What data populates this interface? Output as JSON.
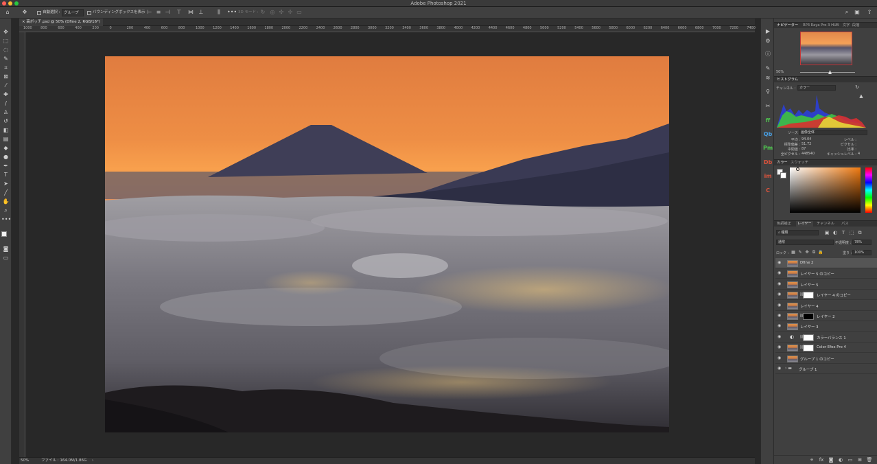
{
  "window": {
    "title": "Adobe Photoshop 2021"
  },
  "options_bar": {
    "auto_select_label": "自動選択 :",
    "auto_select_target": "グループ",
    "bounding_box_label": "バウンディングボックスを表示",
    "mode_3d_label": "3D モード :"
  },
  "document_tab": {
    "label": "高ボッチ.psd @ 50% (Dfine 2, RGB/16*)",
    "close": "×"
  },
  "ruler_top": [
    "1000",
    "800",
    "600",
    "400",
    "200",
    "0",
    "200",
    "400",
    "600",
    "800",
    "1000",
    "1200",
    "1400",
    "1600",
    "1800",
    "2000",
    "2200",
    "2400",
    "2600",
    "2800",
    "3000",
    "3200",
    "3400",
    "3600",
    "3800",
    "4000",
    "4200",
    "4400",
    "4600",
    "4800",
    "5000",
    "5200",
    "5400",
    "5600",
    "5800",
    "6000",
    "6200",
    "6400",
    "6600",
    "6800",
    "7000",
    "7200",
    "7400"
  ],
  "status": {
    "zoom": "50%",
    "file_info": "ファイル : 164.0M/1.86G",
    "arrow": "›"
  },
  "navigator": {
    "tabs": [
      "ナビゲーター",
      "RP3 Raya Pro 3 HUB",
      "文字",
      "段落"
    ],
    "zoom": "50%"
  },
  "histogram": {
    "title": "ヒストグラム",
    "channel_label": "チャンネル :",
    "channel_value": "カラー",
    "source_label": "ソース :",
    "source_value": "画像全体",
    "stats": [
      {
        "label": "平均 :",
        "value": "94.04"
      },
      {
        "label": "標準偏差 :",
        "value": "51.72"
      },
      {
        "label": "中間値 :",
        "value": "87"
      },
      {
        "label": "全ピクセル :",
        "value": "448540"
      }
    ],
    "stats_right": [
      {
        "label": "レベル :",
        "value": ""
      },
      {
        "label": "ピクセル :",
        "value": ""
      },
      {
        "label": "比率 :",
        "value": ""
      },
      {
        "label": "キャッシュレベル :",
        "value": "4"
      }
    ]
  },
  "color_panel": {
    "tabs": [
      "カラー",
      "スウォッチ"
    ]
  },
  "layers_panel": {
    "tabs": [
      "色調補正",
      "レイヤー",
      "チャンネル",
      "パス"
    ],
    "filter_kind": "種類",
    "blend_mode": "通常",
    "opacity_label": "不透明度 :",
    "opacity_value": "78%",
    "lock_label": "ロック :",
    "fill_label": "塗り :",
    "fill_value": "100%",
    "layers": [
      {
        "name": "Dfine 2",
        "mask": "",
        "selected": true
      },
      {
        "name": "レイヤー 5 のコピー",
        "mask": ""
      },
      {
        "name": "レイヤー 5",
        "mask": ""
      },
      {
        "name": "レイヤー 4 のコピー",
        "mask": "white"
      },
      {
        "name": "レイヤー 4",
        "mask": ""
      },
      {
        "name": "レイヤー 2",
        "mask": "black"
      },
      {
        "name": "レイヤー 3",
        "mask": ""
      },
      {
        "name": "カラーバランス 1",
        "mask": "white",
        "adjustment": true
      },
      {
        "name": "Color Efex Pro 4",
        "mask": "white"
      },
      {
        "name": "グループ 1 のコピー",
        "mask": ""
      },
      {
        "name": "グループ 1",
        "mask": "",
        "group": true
      }
    ]
  },
  "plugin_strip": [
    "ff",
    "Qb",
    "Pm",
    "Db",
    "im",
    "C"
  ],
  "colors": {
    "sky_top": "#d87a3e",
    "sky_glow": "#f49a4b",
    "mountain": "#3f3e57",
    "cloud": "#8b8a90",
    "city_lights": "#ffd27a"
  }
}
